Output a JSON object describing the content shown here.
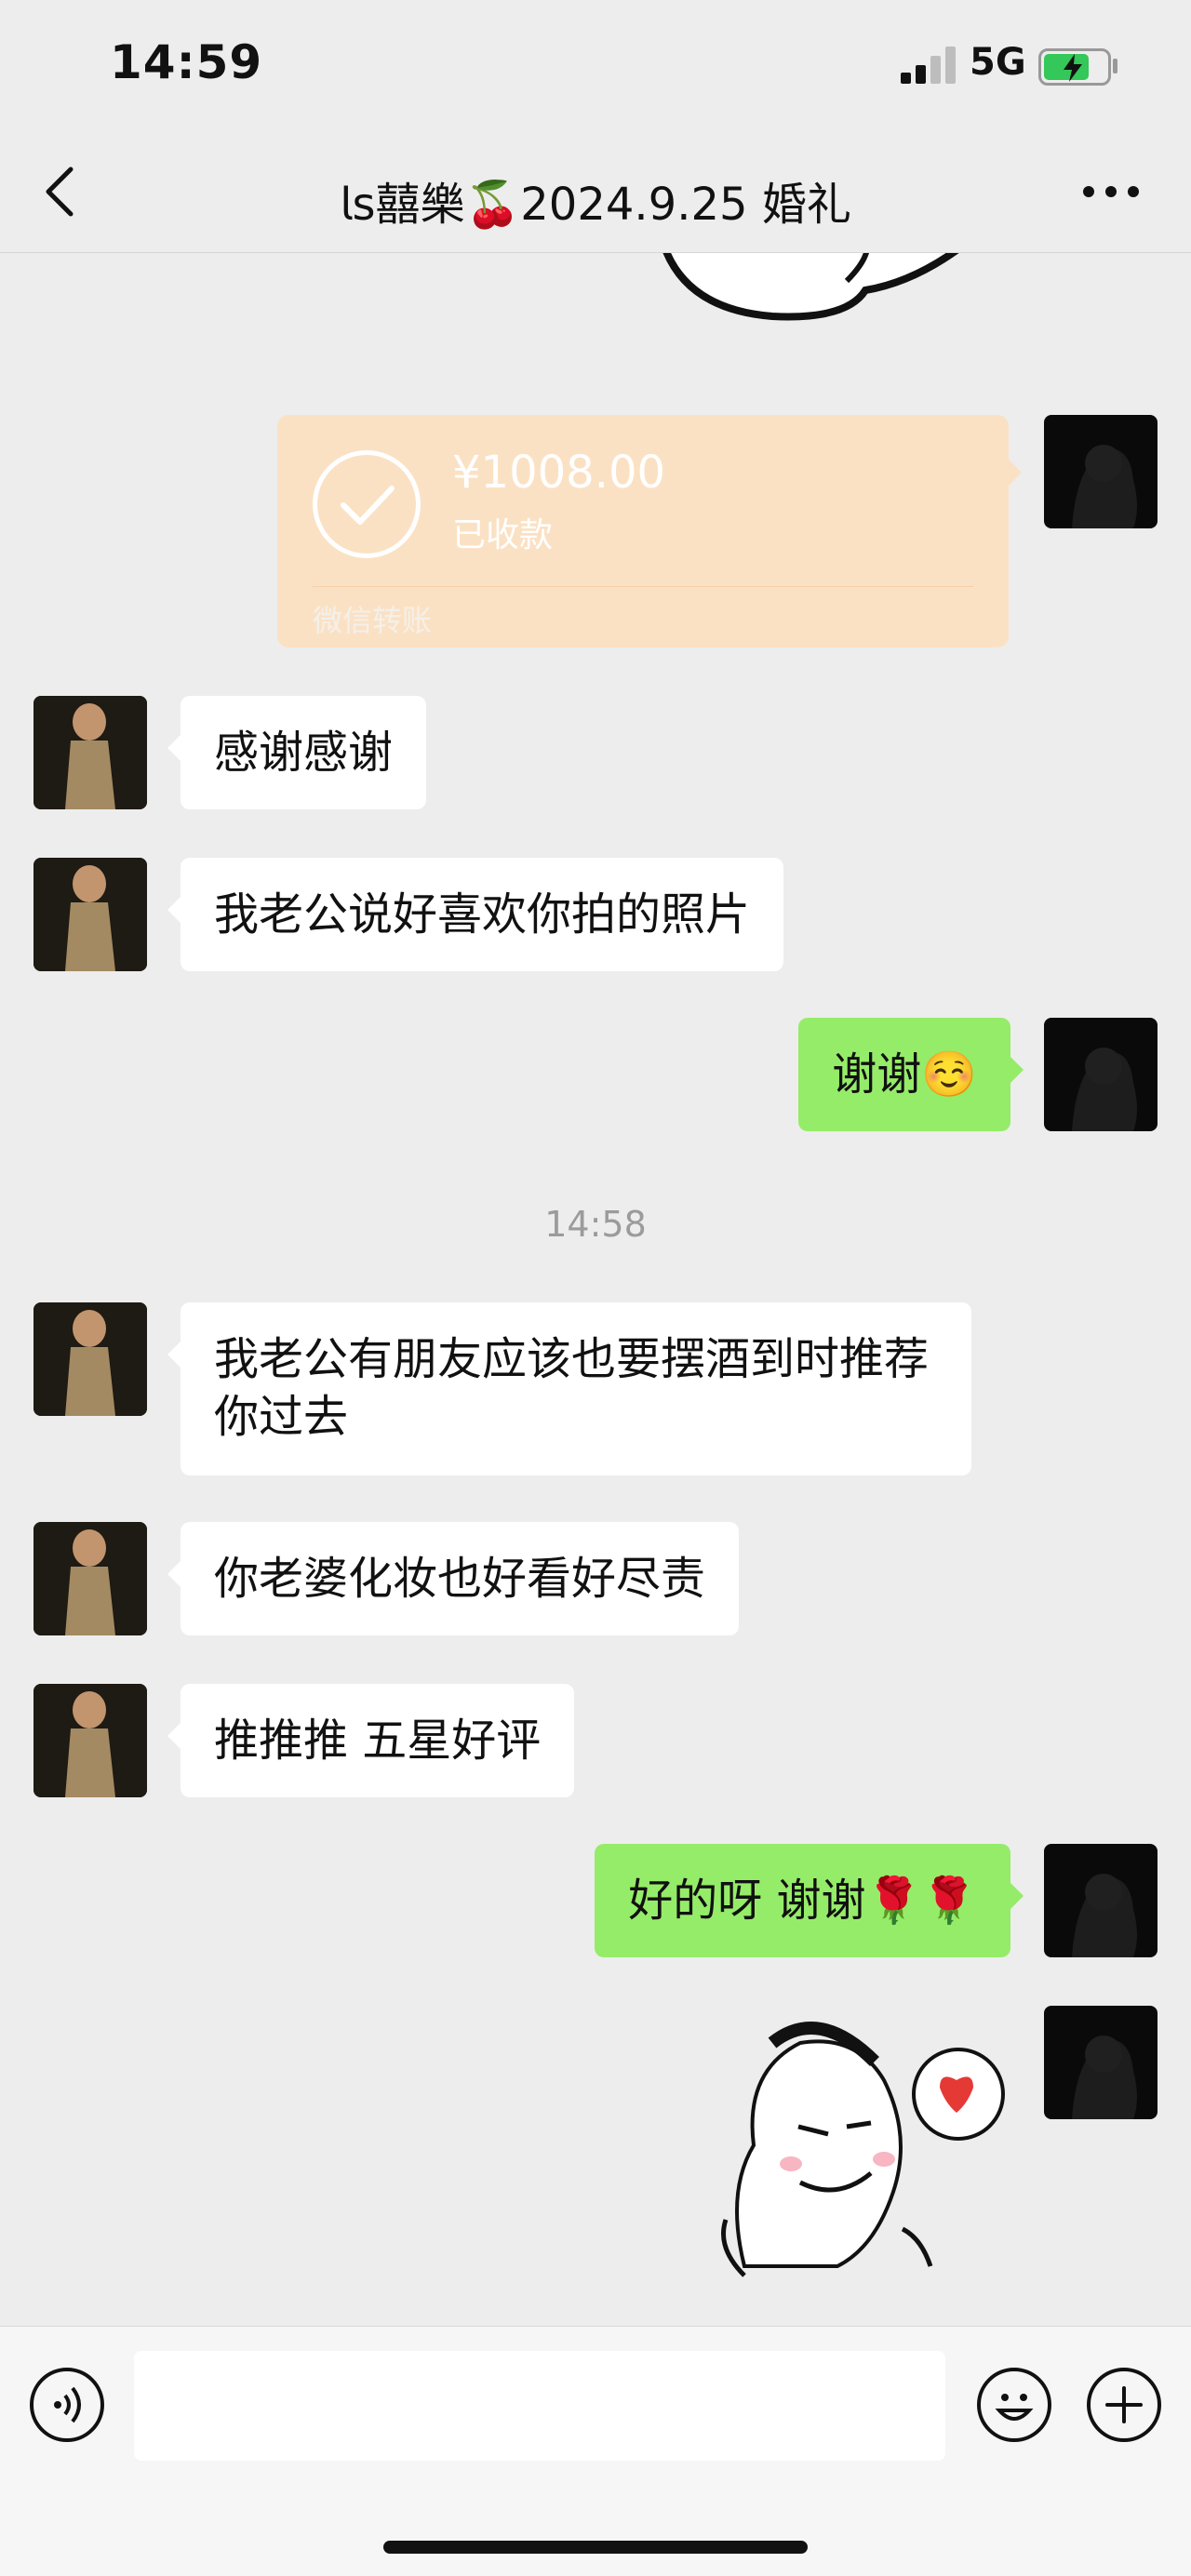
{
  "status_bar": {
    "time": "14:59",
    "network": "5G",
    "battery_level": 0.7
  },
  "nav": {
    "title": "𝗅𝗌囍樂🍒2024.9.25 婚礼"
  },
  "transfer": {
    "amount": "¥1008.00",
    "status": "已收款",
    "footer": "微信转账"
  },
  "messages": [
    {
      "side": "left",
      "text": "感谢感谢"
    },
    {
      "side": "left",
      "text": "我老公说好喜欢你拍的照片"
    },
    {
      "side": "right",
      "text": "谢谢☺️"
    },
    {
      "side": "left",
      "text": "我老公有朋友应该也要摆酒到时推荐你过去"
    },
    {
      "side": "left",
      "text": "你老婆化妆也好看好尽责"
    },
    {
      "side": "left",
      "text": "推推推 五星好评"
    },
    {
      "side": "right",
      "text": "好的呀  谢谢🌹🌹"
    }
  ],
  "time_divider": "14:58",
  "colors": {
    "background": "#ededed",
    "my_bubble": "#95ec69",
    "their_bubble": "#ffffff",
    "transfer_card": "#fbe1c4"
  },
  "icons": {
    "back": "chevron-left-icon",
    "more": "more-dots-icon",
    "voice": "voice-icon",
    "emoji": "emoji-icon",
    "plus": "plus-icon"
  }
}
